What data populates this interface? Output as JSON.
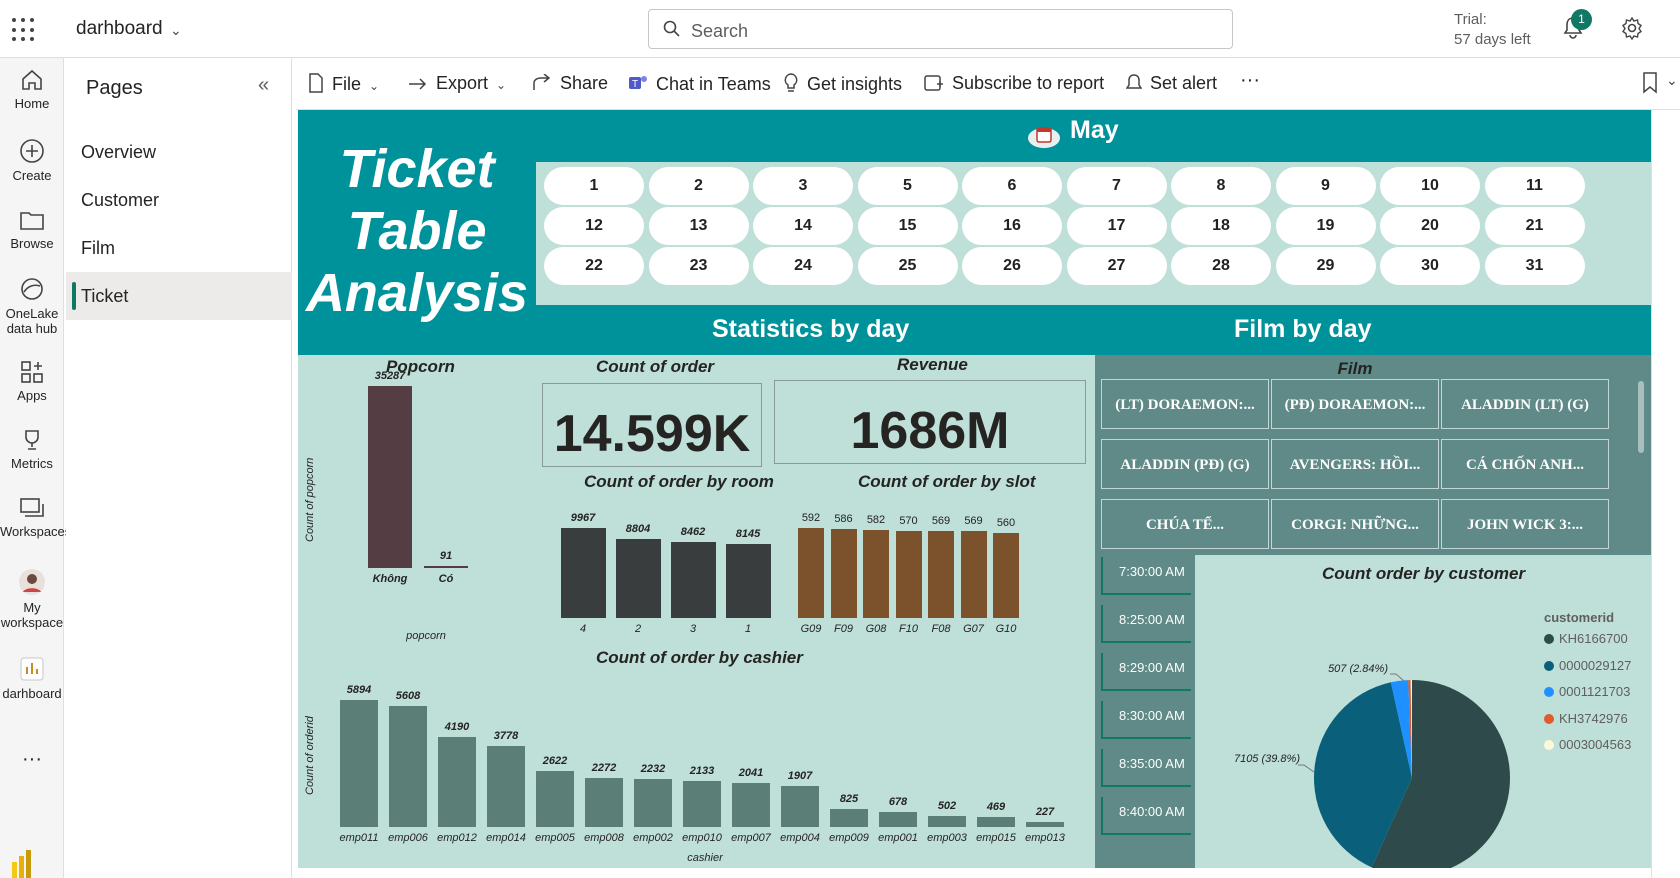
{
  "topbar": {
    "workspace_title": "darhboard",
    "search_placeholder": "Search",
    "trial_line1": "Trial:",
    "trial_line2": "57 days left",
    "notification_count": "1"
  },
  "leftnav": {
    "items": [
      {
        "label": "Home",
        "icon": "home-icon"
      },
      {
        "label": "Create",
        "icon": "plus-circle-icon"
      },
      {
        "label": "Browse",
        "icon": "folder-icon"
      },
      {
        "label": "OneLake data hub",
        "icon": "onelake-icon"
      },
      {
        "label": "Apps",
        "icon": "apps-icon"
      },
      {
        "label": "Metrics",
        "icon": "trophy-icon"
      },
      {
        "label": "Workspaces",
        "icon": "workspaces-icon"
      },
      {
        "label": "My workspace",
        "icon": "avatar-icon"
      },
      {
        "label": "darhboard",
        "icon": "report-icon"
      }
    ],
    "more": "···"
  },
  "pages": {
    "title": "Pages",
    "items": [
      "Overview",
      "Customer",
      "Film",
      "Ticket"
    ],
    "active": "Ticket"
  },
  "toolbar": {
    "file": "File",
    "export": "Export",
    "share": "Share",
    "chat": "Chat in Teams",
    "insights": "Get insights",
    "subscribe": "Subscribe to report",
    "alert": "Set alert",
    "more": "···"
  },
  "report": {
    "title_lines": [
      "Ticket",
      "Table",
      "Analysis"
    ],
    "month": "May",
    "days": [
      "1",
      "2",
      "3",
      "5",
      "6",
      "7",
      "8",
      "9",
      "10",
      "11",
      "12",
      "13",
      "14",
      "15",
      "16",
      "17",
      "18",
      "19",
      "20",
      "21",
      "22",
      "23",
      "24",
      "25",
      "26",
      "27",
      "28",
      "29",
      "30",
      "31"
    ],
    "stats_title": "Statistics by day",
    "film_title": "Film by day",
    "count_order_title": "Count of order",
    "count_order_value": "14.599K",
    "revenue_title": "Revenue",
    "revenue_value": "1686M",
    "film_slicer_title": "Film",
    "films": [
      "(LT) DORAEMON:...",
      "(PĐ) DORAEMON:...",
      "ALADDIN (LT) (G)",
      "ALADDIN (PĐ) (G)",
      "AVENGERS: HỒI...",
      "CÁ CHỐN ANH...",
      "CHÚA TỂ...",
      "CORGI: NHỮNG...",
      "JOHN WICK 3:..."
    ],
    "times": [
      "7:30:00 AM",
      "8:25:00 AM",
      "8:29:00 AM",
      "8:30:00 AM",
      "8:35:00 AM",
      "8:40:00 AM"
    ],
    "colors": {
      "teal": "#00929a",
      "canvas": "#bfdfd9",
      "popcorn_bar": "#553d44",
      "room_bar": "#3a3d3d",
      "slot_bar": "#7b522b",
      "cashier_bar": "#5b7f76",
      "slicer": "#5f8a88"
    }
  },
  "chart_data": [
    {
      "id": "popcorn",
      "type": "bar",
      "title": "Popcorn",
      "xlabel": "popcorn",
      "ylabel": "Count of popcorn",
      "categories": [
        "Không",
        "Có"
      ],
      "values": [
        35287,
        91
      ]
    },
    {
      "id": "room",
      "type": "bar",
      "title": "Count of order by room",
      "categories": [
        "4",
        "2",
        "3",
        "1"
      ],
      "values": [
        9967,
        8804,
        8462,
        8145
      ]
    },
    {
      "id": "slot",
      "type": "bar",
      "title": "Count of order by slot",
      "categories": [
        "G09",
        "F09",
        "G08",
        "F10",
        "F08",
        "G07",
        "G10"
      ],
      "values": [
        592,
        586,
        582,
        570,
        569,
        569,
        560
      ]
    },
    {
      "id": "cashier",
      "type": "bar",
      "title": "Count of order by cashier",
      "xlabel": "cashier",
      "ylabel": "Count of orderid",
      "categories": [
        "emp011",
        "emp006",
        "emp012",
        "emp014",
        "emp005",
        "emp008",
        "emp002",
        "emp010",
        "emp007",
        "emp004",
        "emp009",
        "emp001",
        "emp003",
        "emp015",
        "emp013"
      ],
      "values": [
        5894,
        5608,
        4190,
        3778,
        2622,
        2272,
        2232,
        2133,
        2041,
        1907,
        825,
        678,
        502,
        469,
        227
      ]
    },
    {
      "id": "customer",
      "type": "pie",
      "title": "Count order by customer",
      "legend_title": "customerid",
      "legend": "right",
      "series": [
        {
          "name": "KH6166700",
          "value": 10132,
          "label": "10132 (56.76%)",
          "color": "#2f4a4a"
        },
        {
          "name": "0000029127",
          "value": 7105,
          "label": "7105 (39.8%)",
          "color": "#0a5f7a"
        },
        {
          "name": "0001121703",
          "value": 507,
          "label": "507 (2.84%)",
          "color": "#1e90ff"
        },
        {
          "name": "KH3742976",
          "value": 70,
          "color": "#e05a2b"
        },
        {
          "name": "0003004563",
          "value": 40,
          "color": "#fff8d6"
        }
      ]
    }
  ]
}
